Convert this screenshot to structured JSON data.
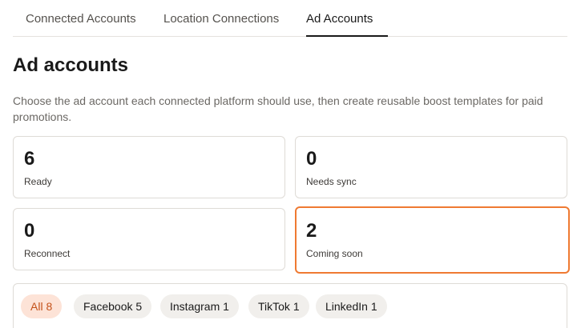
{
  "tabs": [
    {
      "label": "Connected Accounts"
    },
    {
      "label": "Location Connections"
    },
    {
      "label": "Ad Accounts",
      "active": true
    }
  ],
  "header": {
    "title": "Ad accounts",
    "description": "Choose the ad account each connected platform should use, then create reusable boost templates for paid promotions."
  },
  "stats": [
    {
      "value": "6",
      "label": "Ready"
    },
    {
      "value": "0",
      "label": "Needs sync"
    },
    {
      "value": "0",
      "label": "Reconnect"
    },
    {
      "value": "2",
      "label": "Coming soon",
      "highlighted": true
    }
  ],
  "filters": [
    {
      "label": "All 8",
      "active": true
    },
    {
      "label": "Facebook 5"
    },
    {
      "label": "Instagram 1"
    },
    {
      "label": "TikTok 1"
    },
    {
      "label": "LinkedIn 1"
    }
  ],
  "colors": {
    "accent": "#ef7a32",
    "active_chip_bg": "#fde3d7",
    "active_chip_text": "#c4521a",
    "chip_bg": "#f1efec"
  }
}
